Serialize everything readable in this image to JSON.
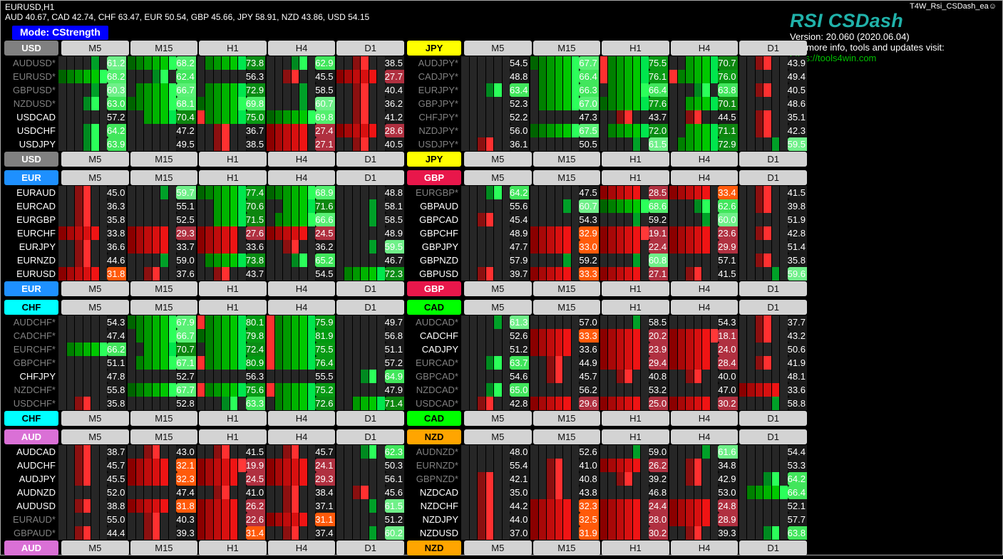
{
  "window": {
    "symbol_timeframe": "EURUSD,H1",
    "strengths_line": "AUD 40.67, CAD 42.74, CHF 63.47, EUR 50.54, GBP 45.66, JPY 58.91, NZD 43.86, USD 54.15",
    "mode_button": "Mode: CStrength"
  },
  "brand": {
    "ea_name": "T4W_Rsi_CSDash_ea",
    "smiley": "☺",
    "title": "RSI CSDash",
    "version": "Version: 20.060 (2020.06.04)",
    "info": "For more info, tools and updates visit:",
    "url": "https://tools4win.com",
    "title_color": "#20B2AA",
    "url_color": "#00C000"
  },
  "timeframes": [
    "M5",
    "M15",
    "H1",
    "H4",
    "D1"
  ],
  "currency_colors": {
    "USD": {
      "bg": "#808080",
      "fg": "#ffffff"
    },
    "JPY": {
      "bg": "#FFFF00",
      "fg": "#000000"
    },
    "EUR": {
      "bg": "#1E90FF",
      "fg": "#ffffff"
    },
    "GBP": {
      "bg": "#E8174B",
      "fg": "#ffffff"
    },
    "CHF": {
      "bg": "#00FFFF",
      "fg": "#000000"
    },
    "CAD": {
      "bg": "#00FF00",
      "fg": "#000000"
    },
    "AUD": {
      "bg": "#DA70D6",
      "fg": "#ffffff"
    },
    "NZD": {
      "bg": "#FFA500",
      "fg": "#000000"
    }
  },
  "blocks": [
    {
      "currency": "USD",
      "rows": [
        {
          "pair": "AUDUSD*",
          "starred": true,
          "values": [
            61.2,
            68.2,
            73.8,
            62.9,
            38.5
          ]
        },
        {
          "pair": "EURUSD*",
          "starred": true,
          "values": [
            68.2,
            62.4,
            56.3,
            45.5,
            27.7
          ]
        },
        {
          "pair": "GBPUSD*",
          "starred": true,
          "values": [
            60.3,
            66.7,
            72.9,
            58.5,
            40.4
          ]
        },
        {
          "pair": "NZDUSD*",
          "starred": true,
          "values": [
            63.0,
            68.1,
            69.8,
            60.7,
            36.2
          ]
        },
        {
          "pair": "USDCAD",
          "starred": false,
          "values": [
            57.2,
            70.4,
            75.0,
            69.8,
            41.2
          ]
        },
        {
          "pair": "USDCHF",
          "starred": false,
          "values": [
            64.2,
            47.2,
            36.7,
            27.4,
            28.6
          ]
        },
        {
          "pair": "USDJPY",
          "starred": false,
          "values": [
            63.9,
            49.5,
            38.5,
            27.1,
            40.5
          ]
        }
      ]
    },
    {
      "currency": "JPY",
      "rows": [
        {
          "pair": "AUDJPY*",
          "starred": true,
          "values": [
            54.5,
            67.7,
            75.5,
            70.7,
            43.9
          ]
        },
        {
          "pair": "CADJPY*",
          "starred": true,
          "values": [
            48.8,
            66.4,
            76.1,
            76.0,
            49.4
          ]
        },
        {
          "pair": "EURJPY*",
          "starred": true,
          "values": [
            63.4,
            66.3,
            66.4,
            63.8,
            40.5
          ]
        },
        {
          "pair": "GBPJPY*",
          "starred": true,
          "values": [
            52.3,
            67.0,
            77.6,
            70.1,
            48.6
          ]
        },
        {
          "pair": "CHFJPY*",
          "starred": true,
          "values": [
            52.2,
            47.3,
            43.7,
            44.5,
            35.1
          ]
        },
        {
          "pair": "NZDJPY*",
          "starred": true,
          "values": [
            56.0,
            67.5,
            72.0,
            71.1,
            42.3
          ]
        },
        {
          "pair": "USDJPY*",
          "starred": true,
          "values": [
            36.1,
            50.5,
            61.5,
            72.9,
            59.5
          ]
        }
      ]
    },
    {
      "currency": "EUR",
      "rows": [
        {
          "pair": "EURAUD",
          "starred": false,
          "values": [
            45.0,
            59.7,
            77.4,
            68.9,
            48.8
          ]
        },
        {
          "pair": "EURCAD",
          "starred": false,
          "values": [
            36.3,
            55.1,
            70.6,
            71.6,
            58.1
          ]
        },
        {
          "pair": "EURGBP",
          "starred": false,
          "values": [
            35.8,
            52.5,
            71.5,
            66.6,
            58.5
          ]
        },
        {
          "pair": "EURCHF",
          "starred": false,
          "values": [
            33.8,
            29.3,
            27.6,
            24.5,
            48.9
          ]
        },
        {
          "pair": "EURJPY",
          "starred": false,
          "values": [
            36.6,
            33.7,
            33.6,
            36.2,
            59.5
          ]
        },
        {
          "pair": "EURNZD",
          "starred": false,
          "values": [
            44.6,
            59.0,
            73.8,
            65.2,
            46.7
          ]
        },
        {
          "pair": "EURUSD",
          "starred": false,
          "values": [
            31.8,
            37.6,
            43.7,
            54.5,
            72.3
          ]
        }
      ]
    },
    {
      "currency": "GBP",
      "rows": [
        {
          "pair": "EURGBP*",
          "starred": true,
          "values": [
            64.2,
            47.5,
            28.5,
            33.4,
            41.5
          ]
        },
        {
          "pair": "GBPAUD",
          "starred": false,
          "values": [
            55.6,
            60.7,
            68.6,
            62.6,
            39.8
          ]
        },
        {
          "pair": "GBPCAD",
          "starred": false,
          "values": [
            45.4,
            54.3,
            59.2,
            60.0,
            51.9
          ]
        },
        {
          "pair": "GBPCHF",
          "starred": false,
          "values": [
            48.9,
            32.9,
            19.1,
            23.6,
            42.8
          ]
        },
        {
          "pair": "GBPJPY",
          "starred": false,
          "values": [
            47.7,
            33.0,
            22.4,
            29.9,
            51.4
          ]
        },
        {
          "pair": "GBPNZD",
          "starred": false,
          "values": [
            57.9,
            59.2,
            60.8,
            57.1,
            35.8
          ]
        },
        {
          "pair": "GBPUSD",
          "starred": false,
          "values": [
            39.7,
            33.3,
            27.1,
            41.5,
            59.6
          ]
        }
      ]
    },
    {
      "currency": "CHF",
      "rows": [
        {
          "pair": "AUDCHF*",
          "starred": true,
          "values": [
            54.3,
            67.9,
            80.1,
            75.9,
            49.7
          ]
        },
        {
          "pair": "CADCHF*",
          "starred": true,
          "values": [
            47.4,
            66.7,
            79.8,
            81.9,
            56.8
          ]
        },
        {
          "pair": "EURCHF*",
          "starred": true,
          "values": [
            66.2,
            70.7,
            72.4,
            75.5,
            51.1
          ]
        },
        {
          "pair": "GBPCHF*",
          "starred": true,
          "values": [
            51.1,
            67.1,
            80.9,
            76.4,
            57.2
          ]
        },
        {
          "pair": "CHFJPY",
          "starred": false,
          "values": [
            47.8,
            52.7,
            56.3,
            55.5,
            64.9
          ]
        },
        {
          "pair": "NZDCHF*",
          "starred": true,
          "values": [
            55.8,
            67.7,
            75.6,
            75.2,
            47.9
          ]
        },
        {
          "pair": "USDCHF*",
          "starred": true,
          "values": [
            35.8,
            52.8,
            63.3,
            72.6,
            71.4
          ]
        }
      ]
    },
    {
      "currency": "CAD",
      "rows": [
        {
          "pair": "AUDCAD*",
          "starred": true,
          "values": [
            61.3,
            57.0,
            58.5,
            54.3,
            37.7
          ]
        },
        {
          "pair": "CADCHF",
          "starred": false,
          "values": [
            52.6,
            33.3,
            20.2,
            18.1,
            43.2
          ]
        },
        {
          "pair": "CADJPY",
          "starred": false,
          "values": [
            51.2,
            33.6,
            23.9,
            24.0,
            50.6
          ]
        },
        {
          "pair": "EURCAD*",
          "starred": true,
          "values": [
            63.7,
            44.9,
            29.4,
            28.4,
            41.9
          ]
        },
        {
          "pair": "GBPCAD*",
          "starred": true,
          "values": [
            54.6,
            45.7,
            40.8,
            40.0,
            48.1
          ]
        },
        {
          "pair": "NZDCAD*",
          "starred": true,
          "values": [
            65.0,
            56.2,
            53.2,
            47.0,
            33.6
          ]
        },
        {
          "pair": "USDCAD*",
          "starred": true,
          "values": [
            42.8,
            29.6,
            25.0,
            30.2,
            58.8
          ]
        }
      ]
    },
    {
      "currency": "AUD",
      "rows": [
        {
          "pair": "AUDCAD",
          "starred": false,
          "values": [
            38.7,
            43.0,
            41.5,
            45.7,
            62.3
          ]
        },
        {
          "pair": "AUDCHF",
          "starred": false,
          "values": [
            45.7,
            32.1,
            19.9,
            24.1,
            50.3
          ]
        },
        {
          "pair": "AUDJPY",
          "starred": false,
          "values": [
            45.5,
            32.3,
            24.5,
            29.3,
            56.1
          ]
        },
        {
          "pair": "AUDNZD",
          "starred": false,
          "values": [
            52.0,
            47.4,
            41.0,
            38.4,
            45.6
          ]
        },
        {
          "pair": "AUDUSD",
          "starred": false,
          "values": [
            38.8,
            31.8,
            26.2,
            37.1,
            61.5
          ]
        },
        {
          "pair": "EURAUD*",
          "starred": true,
          "values": [
            55.0,
            40.3,
            22.6,
            31.1,
            51.2
          ]
        },
        {
          "pair": "GBPAUD*",
          "starred": true,
          "values": [
            44.4,
            39.3,
            31.4,
            37.4,
            60.2
          ]
        }
      ]
    },
    {
      "currency": "NZD",
      "rows": [
        {
          "pair": "AUDNZD*",
          "starred": true,
          "values": [
            48.0,
            52.6,
            59.0,
            61.6,
            54.4
          ]
        },
        {
          "pair": "EURNZD*",
          "starred": true,
          "values": [
            55.4,
            41.0,
            26.2,
            34.8,
            53.3
          ]
        },
        {
          "pair": "GBPNZD*",
          "starred": true,
          "values": [
            42.1,
            40.8,
            39.2,
            42.9,
            64.2
          ]
        },
        {
          "pair": "NZDCAD",
          "starred": false,
          "values": [
            35.0,
            43.8,
            46.8,
            53.0,
            66.4
          ]
        },
        {
          "pair": "NZDCHF",
          "starred": false,
          "values": [
            44.2,
            32.3,
            24.4,
            24.8,
            52.1
          ]
        },
        {
          "pair": "NZDJPY",
          "starred": false,
          "values": [
            44.0,
            32.5,
            28.0,
            28.9,
            57.7
          ]
        },
        {
          "pair": "NZDUSD",
          "starred": false,
          "values": [
            37.0,
            31.9,
            30.2,
            39.3,
            63.8
          ]
        }
      ]
    }
  ]
}
